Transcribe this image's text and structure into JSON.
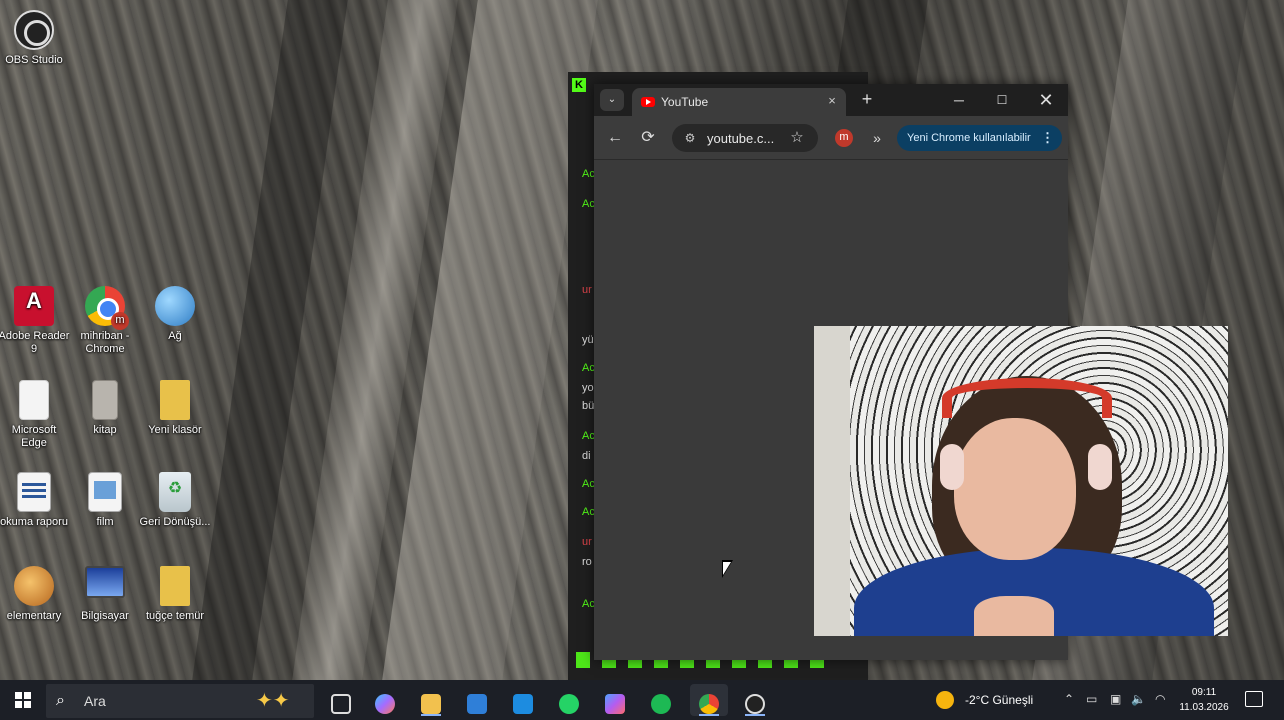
{
  "desktop": {
    "icons": [
      {
        "label": "OBS Studio"
      },
      {
        "label": "Adobe Reader 9"
      },
      {
        "label": "mihriban - Chrome"
      },
      {
        "label": "Ağ"
      },
      {
        "label": "Microsoft Edge"
      },
      {
        "label": "kitap"
      },
      {
        "label": "Yeni klasör"
      },
      {
        "label": "okuma raporu"
      },
      {
        "label": "film"
      },
      {
        "label": "Geri Dönüşü..."
      },
      {
        "label": "elementary"
      },
      {
        "label": "Bilgisayar"
      },
      {
        "label": "tuğçe temür"
      }
    ]
  },
  "chrome": {
    "tab_title": "YouTube",
    "tab_close": "×",
    "new_tab": "+",
    "tab_list": "⌄",
    "url": "youtube.c...",
    "profile_initial": "m",
    "update_label": "Yeni Chrome kullanılabilir",
    "update_menu": "⋮",
    "back": "←",
    "reload": "⟳",
    "star": "☆",
    "extensions_more": "»",
    "minimize": "─",
    "maximize": "☐",
    "close": "✕"
  },
  "bg_app": {
    "badge": "K",
    "rows": [
      "Ac",
      "Ac",
      "ur",
      "yü",
      "Ac",
      "yo",
      "bü",
      "Ac",
      "di",
      "Ac",
      "Ac",
      "ur",
      "ro",
      "Ac"
    ]
  },
  "taskbar": {
    "search_label": "Ara",
    "weather": "-2°C  Güneşli",
    "time": "09:11",
    "date": "11.03.2026",
    "accent": "#8ab4f8"
  }
}
